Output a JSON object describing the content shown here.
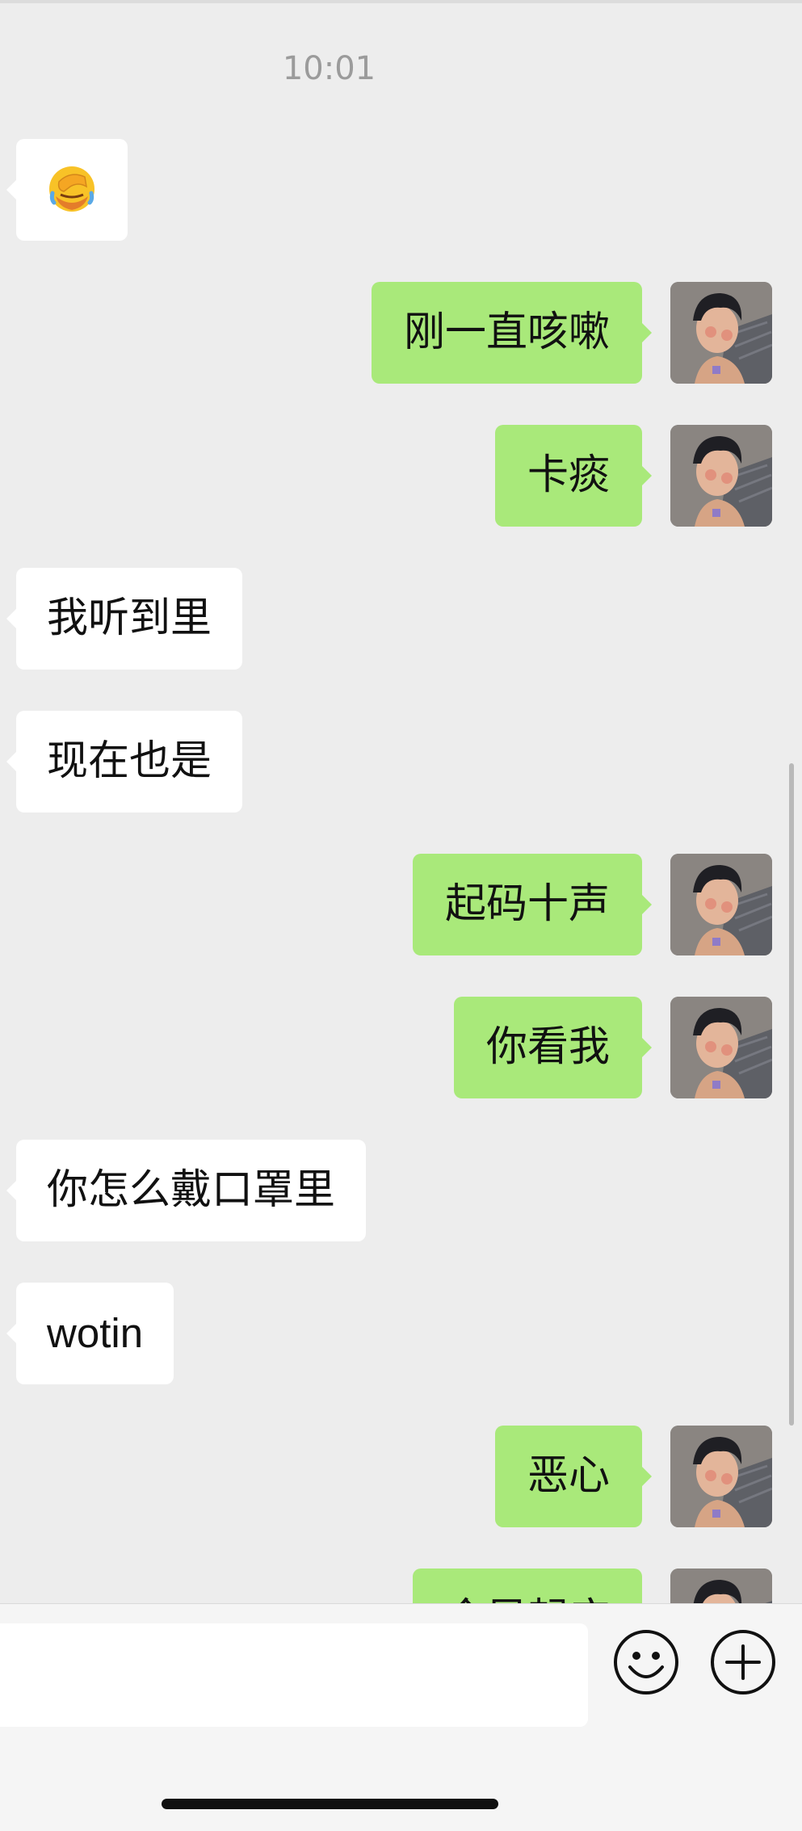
{
  "chat": {
    "timestamp": "10:01",
    "messages": [
      {
        "side": "in",
        "type": "emoji",
        "emoji": "face-palm-emoji"
      },
      {
        "side": "out",
        "text": "刚一直咳嗽"
      },
      {
        "side": "out",
        "text": "卡痰"
      },
      {
        "side": "in",
        "text": "我听到里"
      },
      {
        "side": "in",
        "text": "现在也是"
      },
      {
        "side": "out",
        "text": "起码十声"
      },
      {
        "side": "out",
        "text": "你看我"
      },
      {
        "side": "in",
        "text": "你怎么戴口罩里"
      },
      {
        "side": "in",
        "text": "wotin"
      },
      {
        "side": "out",
        "text": "恶心"
      },
      {
        "side": "out",
        "text": "今早起床"
      }
    ]
  },
  "input_bar": {
    "value": "",
    "emoji_button": "smiley-icon",
    "plus_button": "plus-circle-icon"
  },
  "colors": {
    "background": "#ededed",
    "incoming_bubble": "#ffffff",
    "outgoing_bubble": "#a9e97a",
    "timestamp_text": "#9b9b9b"
  }
}
